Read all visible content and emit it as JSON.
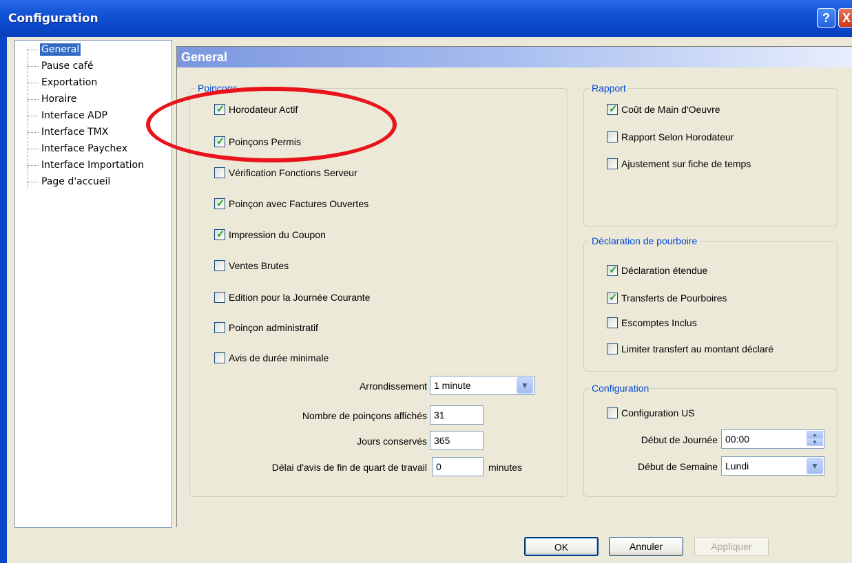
{
  "window": {
    "title": "Configuration",
    "help": "?",
    "close": "X"
  },
  "tree": {
    "items": [
      "General",
      "Pause café",
      "Exportation",
      "Horaire",
      "Interface ADP",
      "Interface TMX",
      "Interface Paychex",
      "Interface Importation",
      "Page d'accueil"
    ],
    "selected": "General"
  },
  "panel": {
    "title": "General"
  },
  "poincons": {
    "legend": "Poinçons",
    "checkboxes": [
      {
        "label": "Horodateur Actif",
        "checked": true
      },
      {
        "label": "Poinçons Permis",
        "checked": true
      },
      {
        "label": "Vérification Fonctions Serveur",
        "checked": false
      },
      {
        "label": "Poinçon avec Factures Ouvertes",
        "checked": true
      },
      {
        "label": "Impression du Coupon",
        "checked": true
      },
      {
        "label": "Ventes Brutes",
        "checked": false
      },
      {
        "label": "Edition pour la Journée Courante",
        "checked": false
      },
      {
        "label": "Poinçon administratif",
        "checked": false
      },
      {
        "label": "Avis de durée minimale",
        "checked": false
      }
    ],
    "arrondissement_label": "Arrondissement",
    "arrondissement_value": "1 minute",
    "nb_label": "Nombre de poinçons affichés",
    "nb_value": "31",
    "jours_label": "Jours conservés",
    "jours_value": "365",
    "delai_label": "Délai d'avis de fin de quart de travail",
    "delai_value": "0",
    "delai_unit": "minutes"
  },
  "rapport": {
    "legend": "Rapport",
    "checkboxes": [
      {
        "label": "Coût de Main d'Oeuvre",
        "checked": true
      },
      {
        "label": "Rapport Selon Horodateur",
        "checked": false
      },
      {
        "label": "Ajustement sur fiche de temps",
        "checked": false
      }
    ]
  },
  "pourboire": {
    "legend": "Déclaration de pourboire",
    "checkboxes": [
      {
        "label": "Déclaration étendue",
        "checked": true
      },
      {
        "label": "Transferts de Pourboires",
        "checked": true
      },
      {
        "label": "Escomptes Inclus",
        "checked": false
      },
      {
        "label": "Limiter transfert au montant déclaré",
        "checked": false
      }
    ]
  },
  "configuration": {
    "legend": "Configuration",
    "us_label": "Configuration US",
    "us_checked": false,
    "debut_journee_label": "Début de Journée",
    "debut_journee_value": "00:00",
    "debut_semaine_label": "Début de Semaine",
    "debut_semaine_value": "Lundi"
  },
  "buttons": {
    "ok": "OK",
    "annuler": "Annuler",
    "appliquer": "Appliquer"
  },
  "colors": {
    "titlebar": "#0a46c9",
    "selection": "#316ac5",
    "legend": "#0046d5",
    "annotation": "#e8141a"
  }
}
